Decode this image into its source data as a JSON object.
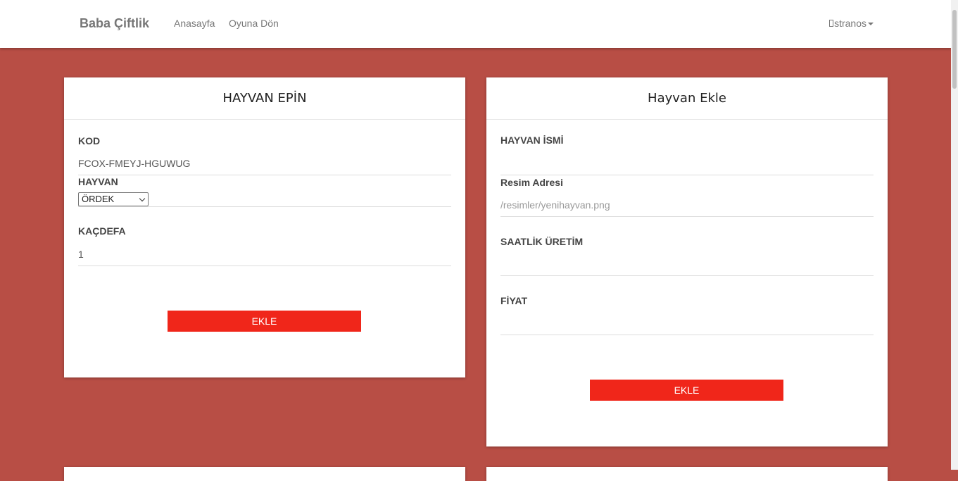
{
  "navbar": {
    "brand": "Baba Çiftlik",
    "links": [
      "Anasayfa",
      "Oyuna Dön"
    ],
    "user": "stranos"
  },
  "epin_card": {
    "title": "HAYVAN EPİN",
    "kod_label": "KOD",
    "kod_value": "FCOX-FMEYJ-HGUWUG",
    "hayvan_label": "HAYVAN",
    "hayvan_selected": "ÖRDEK",
    "kacdefa_label": "KAÇDEFA",
    "kacdefa_value": "1",
    "button": "EKLE"
  },
  "add_card": {
    "title": "Hayvan Ekle",
    "name_label": "HAYVAN İSMİ",
    "name_value": "",
    "image_label": "Resim Adresi",
    "image_placeholder": "/resimler/yenihayvan.png",
    "production_label": "SAATLİK ÜRETİM",
    "production_value": "",
    "price_label": "FİYAT",
    "price_value": "",
    "button": "EKLE"
  },
  "colors": {
    "background": "#b84e45",
    "button": "#f0261a",
    "navbar": "#ffffff"
  }
}
